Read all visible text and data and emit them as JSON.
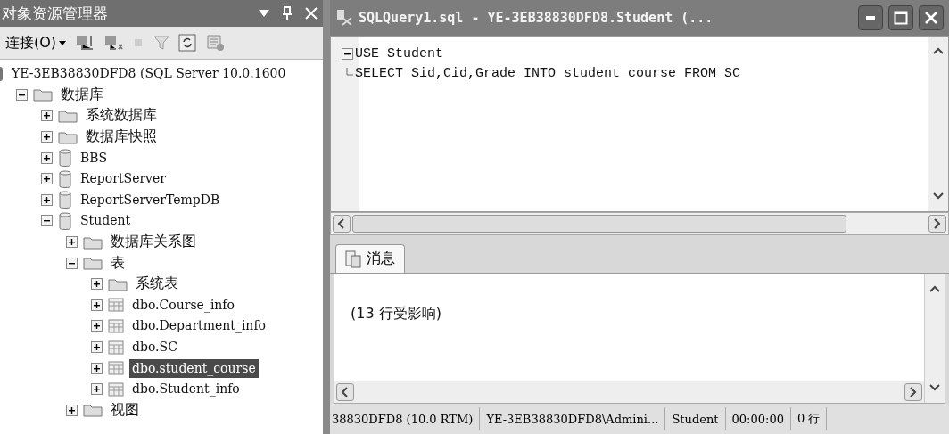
{
  "explorer": {
    "title": "对象资源管理器",
    "connect_label": "连接(O)",
    "tree": [
      {
        "label": "YE-3EB38830DFD8 (SQL Server 10.0.1600",
        "kind": "server",
        "selected": false,
        "children": [
          {
            "label": "数据库",
            "kind": "folder",
            "expanded": true,
            "selected": false,
            "children": [
              {
                "label": "系统数据库",
                "kind": "folder",
                "expanded": false,
                "selected": false
              },
              {
                "label": "数据库快照",
                "kind": "folder",
                "expanded": false,
                "selected": false
              },
              {
                "label": "BBS",
                "kind": "database",
                "expanded": false,
                "selected": false
              },
              {
                "label": "ReportServer",
                "kind": "database",
                "expanded": false,
                "selected": false
              },
              {
                "label": "ReportServerTempDB",
                "kind": "database",
                "expanded": false,
                "selected": false
              },
              {
                "label": "Student",
                "kind": "database",
                "expanded": true,
                "selected": false,
                "children": [
                  {
                    "label": "数据库关系图",
                    "kind": "folder",
                    "expanded": false,
                    "selected": false
                  },
                  {
                    "label": "表",
                    "kind": "folder",
                    "expanded": true,
                    "selected": false,
                    "children": [
                      {
                        "label": "系统表",
                        "kind": "folder",
                        "expanded": false,
                        "selected": false
                      },
                      {
                        "label": "dbo.Course_info",
                        "kind": "table",
                        "expanded": false,
                        "selected": false
                      },
                      {
                        "label": "dbo.Department_info",
                        "kind": "table",
                        "expanded": false,
                        "selected": false
                      },
                      {
                        "label": "dbo.SC",
                        "kind": "table",
                        "expanded": false,
                        "selected": false
                      },
                      {
                        "label": "dbo.student_course",
                        "kind": "table",
                        "expanded": false,
                        "selected": true
                      },
                      {
                        "label": "dbo.Student_info",
                        "kind": "table",
                        "expanded": false,
                        "selected": false
                      }
                    ]
                  },
                  {
                    "label": "视图",
                    "kind": "folder",
                    "expanded": false,
                    "selected": false
                  }
                ]
              }
            ]
          }
        ]
      }
    ]
  },
  "query_window": {
    "title": "SQLQuery1.sql - YE-3EB38830DFD8.Student (...",
    "code_lines": [
      "USE Student",
      "SELECT Sid,Cid,Grade INTO student_course FROM SC"
    ],
    "result_tab": {
      "label": "消息",
      "selected": true
    },
    "messages": [
      "(13 行受影响)"
    ],
    "status_bar": [
      "38830DFD8 (10.0 RTM)",
      "YE-3EB38830DFD8\\Admini...",
      "Student",
      "00:00:00",
      "0 行"
    ]
  }
}
